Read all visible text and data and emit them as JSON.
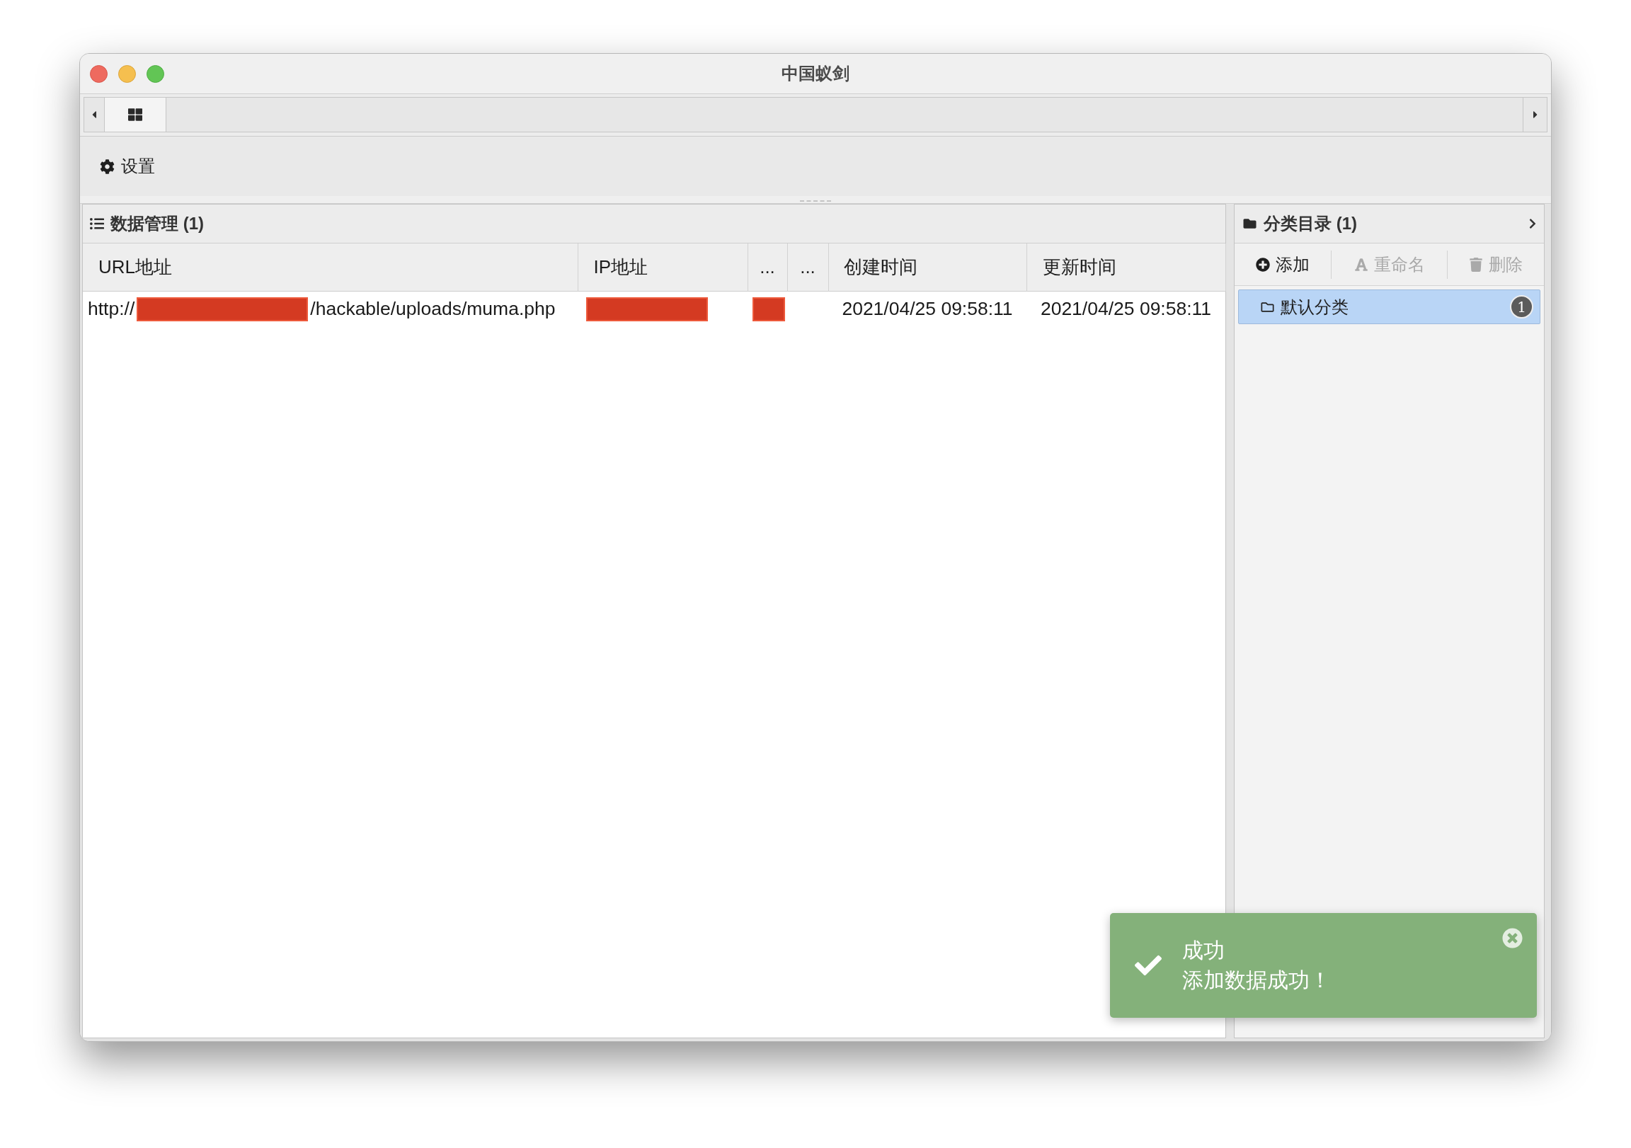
{
  "window": {
    "title": "中国蚁剑"
  },
  "tab_bar": {
    "tabs": [
      {
        "selected": true
      }
    ]
  },
  "toolbar": {
    "buttons": [
      {
        "label": "设置"
      }
    ]
  },
  "data_panel": {
    "title": "数据管理 (1)",
    "table": {
      "columns": [
        "URL地址",
        "IP地址",
        "...",
        "...",
        "创建时间",
        "更新时间"
      ],
      "rows": [
        {
          "cells": [
            {
              "parts": [
                {
                  "kind": "text",
                  "text": "http://"
                },
                {
                  "kind": "redacted"
                },
                {
                  "kind": "text",
                  "text": "/hackable/uploads/muma.php"
                }
              ]
            },
            {
              "parts": [
                {
                  "kind": "redacted"
                }
              ]
            },
            {
              "parts": [
                {
                  "kind": "redacted"
                }
              ]
            },
            null,
            {
              "parts": [
                {
                  "kind": "text",
                  "text": "2021/04/25 09:58:11"
                }
              ]
            },
            {
              "parts": [
                {
                  "kind": "text",
                  "text": "2021/04/25 09:58:11"
                }
              ]
            }
          ]
        }
      ]
    }
  },
  "category_panel": {
    "title": "分类目录 (1)",
    "actions": [
      {
        "label": "添加",
        "disabled": false
      },
      {
        "label": "重命名",
        "disabled": true
      },
      {
        "label": "删除",
        "disabled": true
      }
    ],
    "items": [
      {
        "label": "默认分类",
        "count": "1",
        "selected": true
      }
    ]
  },
  "toast": {
    "kind": "success",
    "title": "成功",
    "message": "添加数据成功！"
  }
}
